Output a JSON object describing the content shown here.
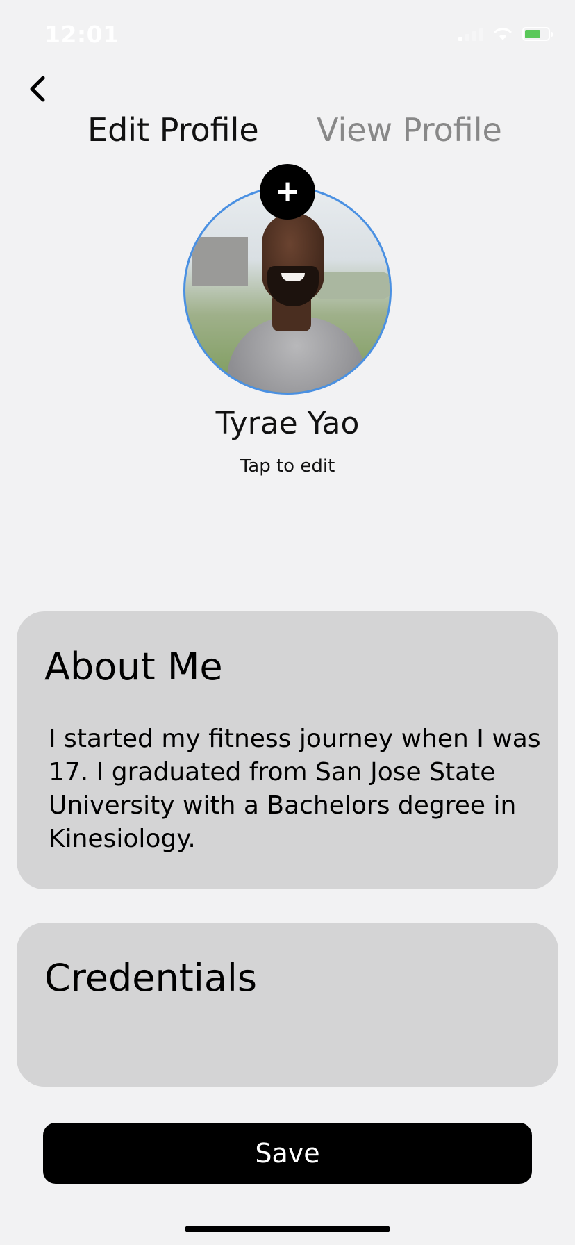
{
  "status_bar": {
    "time": "12:01"
  },
  "tabs": {
    "edit_label": "Edit Profile",
    "view_label": "View Profile"
  },
  "profile": {
    "name": "Tyrae Yao",
    "edit_hint": "Tap to edit",
    "add_photo_label": "+"
  },
  "about": {
    "title": "About Me",
    "text": "I started my fitness journey when I was 17. I graduated from San Jose State University with a Bachelors degree in Kinesiology."
  },
  "credentials": {
    "title": "Credentials"
  },
  "actions": {
    "save_label": "Save"
  },
  "colors": {
    "background": "#f2f2f3",
    "card": "#d4d4d5",
    "avatar_ring": "#4a90e2",
    "inactive_tab": "#888888",
    "battery": "#5ac85a"
  }
}
